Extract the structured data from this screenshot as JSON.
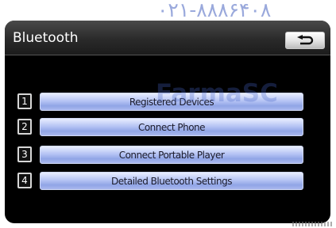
{
  "watermark_top": "۰۲۱-۸۸۸۶۴۰۸",
  "watermark_mid": "FarmaSC",
  "header": {
    "title": "Bluetooth",
    "back_icon": "return-arrow-icon"
  },
  "menu": [
    {
      "number": "1",
      "label": "Registered Devices"
    },
    {
      "number": "2",
      "label": "Connect Phone"
    },
    {
      "number": "3",
      "label": "Connect Portable Player"
    },
    {
      "number": "4",
      "label": "Detailed Bluetooth Settings"
    }
  ],
  "colors": {
    "screen_bg": "#000000",
    "button_blue": "#b6c4f4",
    "watermark": "#9aa9dc"
  }
}
